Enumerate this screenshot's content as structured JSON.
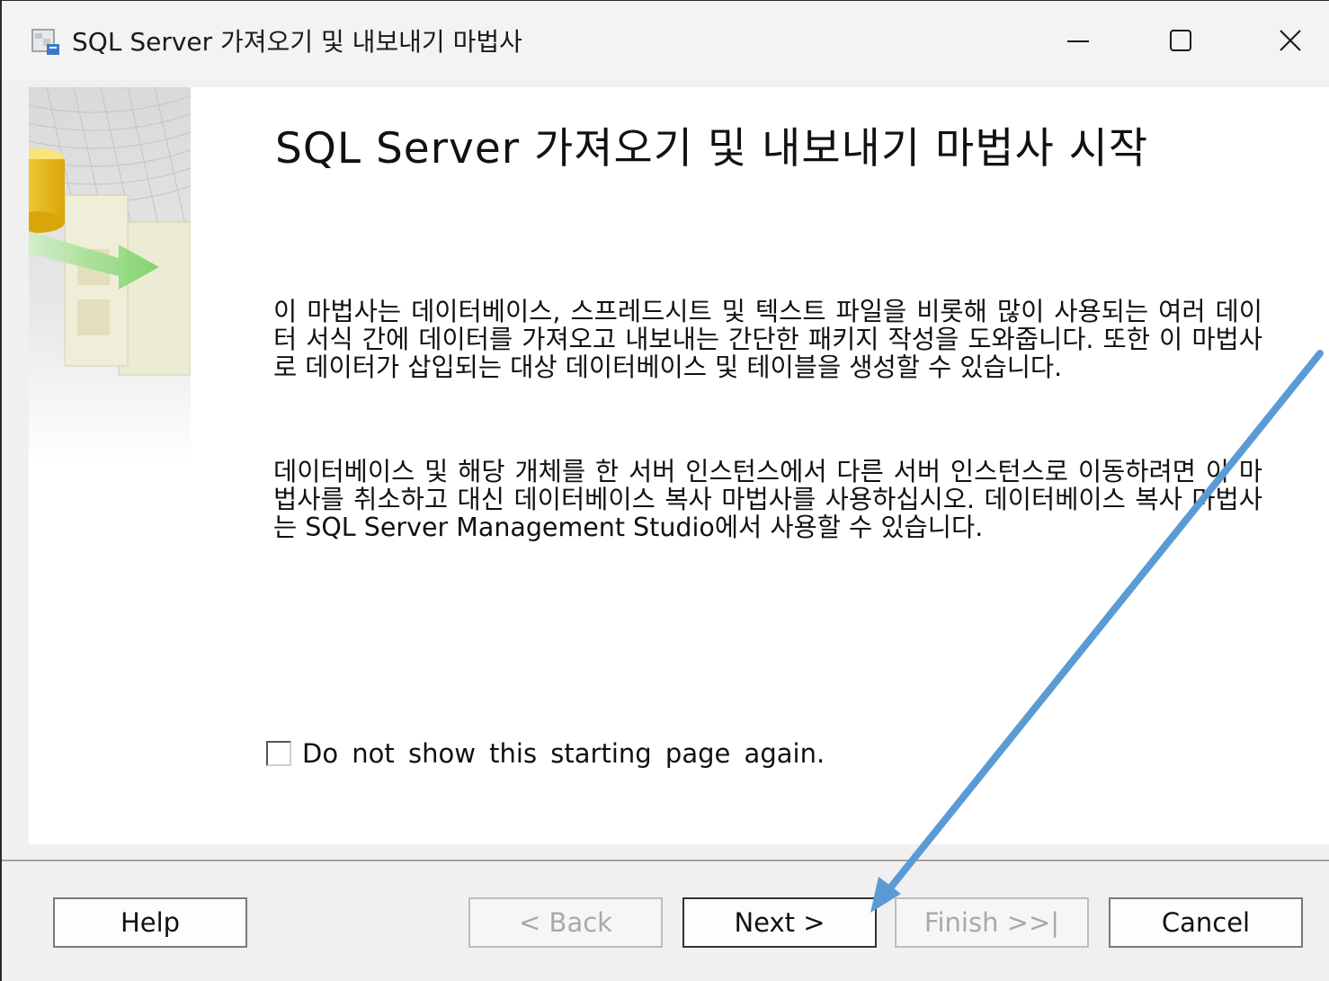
{
  "window": {
    "title": "SQL Server 가져오기 및 내보내기 마법사",
    "controls": {
      "minimize": "—",
      "maximize": "☐",
      "close": "✕"
    }
  },
  "main": {
    "heading": "SQL Server 가져오기 및 내보내기 마법사 시작",
    "paragraph1": "이 마법사는 데이터베이스, 스프레드시트 및 텍스트 파일을 비롯해 많이 사용되는 여러 데이터 서식 간에 데이터를 가져오고 내보내는 간단한 패키지 작성을 도와줍니다. 또한 이 마법사로 데이터가 삽입되는 대상 데이터베이스 및 테이블을 생성할 수 있습니다.",
    "paragraph2": "데이터베이스 및 해당 개체를 한 서버 인스턴스에서 다른 서버 인스턴스로 이동하려면 이 마법사를 취소하고 대신 데이터베이스 복사 마법사를 사용하십시오. 데이터베이스 복사 마법사는 SQL Server Management Studio에서 사용할 수 있습니다.",
    "checkbox": {
      "label": "Do not show this starting page again.",
      "checked": false
    }
  },
  "buttons": {
    "help": "Help",
    "back": "< Back",
    "next": "Next >",
    "finish": "Finish >>|",
    "cancel": "Cancel"
  },
  "annotation": {
    "arrow_color": "#5b9bd5",
    "arrow_target": "next-button"
  },
  "icons": [
    "wizard-app-icon",
    "minimize-icon",
    "maximize-icon",
    "close-icon",
    "wizard-banner-art"
  ]
}
